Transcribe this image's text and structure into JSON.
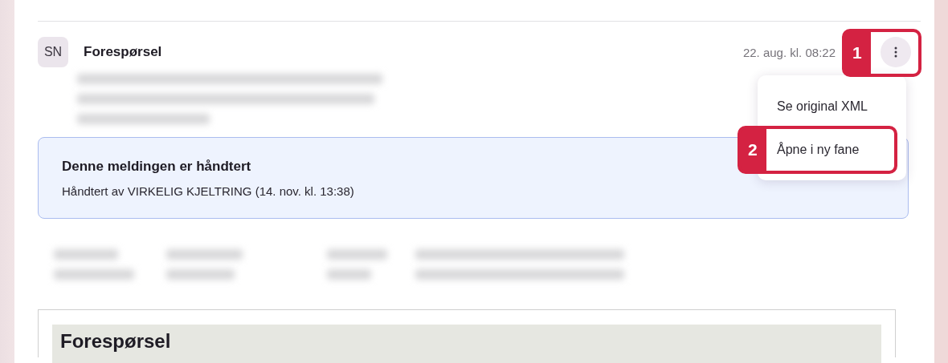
{
  "message": {
    "avatar": "SN",
    "title": "Forespørsel",
    "date": "22. aug. kl. 08:22"
  },
  "menu": {
    "open": true,
    "items": [
      {
        "label": "Se original XML"
      },
      {
        "label": "Åpne i ny fane"
      }
    ]
  },
  "notice": {
    "title": "Denne meldingen er håndtert",
    "text": "Håndtert av VIRKELIG KJELTRING (14. nov. kl. 13:38)"
  },
  "document": {
    "heading": "Forespørsel"
  },
  "callouts": [
    {
      "label": "1"
    },
    {
      "label": "2"
    }
  ]
}
